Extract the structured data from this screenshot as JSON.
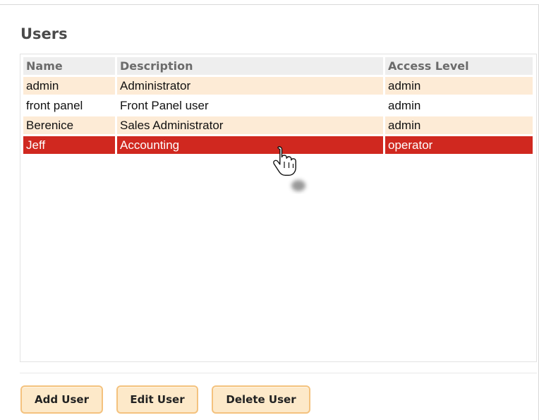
{
  "panel": {
    "title": "Users"
  },
  "table": {
    "columns": [
      "Name",
      "Description",
      "Access Level"
    ],
    "rows": [
      {
        "name": "admin",
        "description": "Administrator",
        "access_level": "admin"
      },
      {
        "name": "front panel",
        "description": "Front Panel user",
        "access_level": "admin"
      },
      {
        "name": "Berenice",
        "description": "Sales Administrator",
        "access_level": "admin"
      },
      {
        "name": "Jeff",
        "description": "Accounting",
        "access_level": "operator"
      }
    ],
    "selected_row_index": 3
  },
  "buttons": {
    "add": "Add User",
    "edit": "Edit User",
    "delete": "Delete User"
  },
  "colors": {
    "row_alt": "#fdebd6",
    "selected": "#d0281f",
    "header_bg": "#eeeeee",
    "button_bg": "#fde9c9",
    "button_border": "#f4c27e"
  },
  "cursor": {
    "icon": "hand-pointer-icon"
  }
}
